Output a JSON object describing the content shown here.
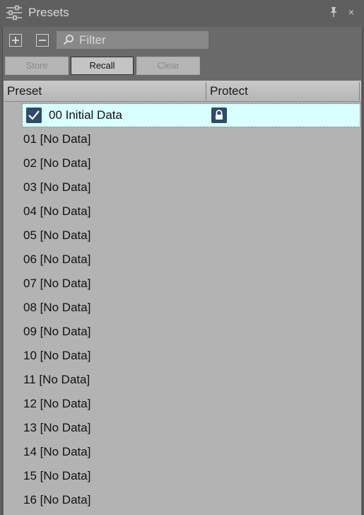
{
  "window": {
    "title": "Presets",
    "icons": {
      "title": "sliders-icon",
      "pin": "pin-icon",
      "close": "close-icon"
    },
    "close_glyph": "×"
  },
  "toolbar": {
    "add_icon": "plus-box-icon",
    "remove_icon": "minus-box-icon",
    "filter_placeholder": "Filter",
    "filter_value": ""
  },
  "buttons": {
    "store": "Store",
    "recall": "Recall",
    "clear": "Clear"
  },
  "table": {
    "columns": [
      "Preset",
      "Protect"
    ],
    "rows": [
      {
        "label": "00 Initial Data",
        "checked": true,
        "protected": true
      },
      {
        "label": "01 [No Data]"
      },
      {
        "label": "02 [No Data]"
      },
      {
        "label": "03 [No Data]"
      },
      {
        "label": "04 [No Data]"
      },
      {
        "label": "05 [No Data]"
      },
      {
        "label": "06 [No Data]"
      },
      {
        "label": "07 [No Data]"
      },
      {
        "label": "08 [No Data]"
      },
      {
        "label": "09 [No Data]"
      },
      {
        "label": "10 [No Data]"
      },
      {
        "label": "11 [No Data]"
      },
      {
        "label": "12 [No Data]"
      },
      {
        "label": "13 [No Data]"
      },
      {
        "label": "14 [No Data]"
      },
      {
        "label": "15 [No Data]"
      },
      {
        "label": "16 [No Data]"
      }
    ]
  },
  "colors": {
    "panel_bg": "#5f5f5f",
    "table_bg": "#b3b3b3",
    "selection_bg": "#d9ffff",
    "icon_badge": "#2e4b68"
  }
}
